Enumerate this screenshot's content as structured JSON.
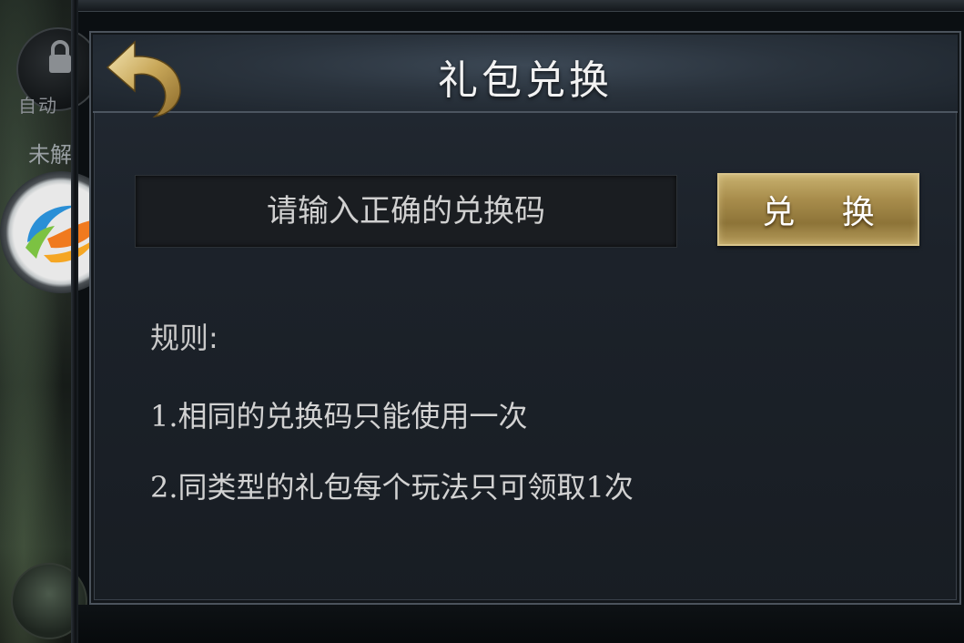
{
  "dialog": {
    "title": "礼包兑换",
    "code_input": {
      "value": "",
      "placeholder": "请输入正确的兑换码"
    },
    "redeem_button_label": "兑 换",
    "rules_title": "规则:",
    "rules": [
      "1.相同的兑换码只能使用一次",
      "2.同类型的礼包每个玩法只可领取1次"
    ],
    "back_icon": "back-arrow-icon",
    "accent_gold": "#c7b06e"
  },
  "side": {
    "auto_label": "自动",
    "unlock_label": "未解"
  }
}
